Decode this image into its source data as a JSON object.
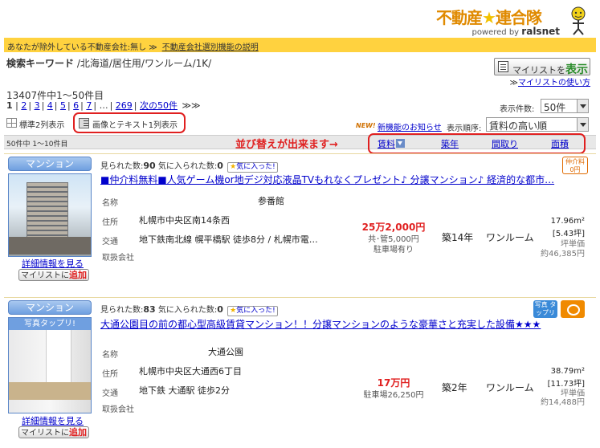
{
  "header": {
    "logo_text_left": "不動産",
    "logo_star": "★",
    "logo_text_right": "連合隊",
    "powered_prefix": "powered by",
    "powered_brand": "ralsnet"
  },
  "notice": {
    "text": "あなたが除外している不動産会社:無し",
    "link_sep": "≫",
    "link": "不動産会社選別機能の説明"
  },
  "search": {
    "label": "検索キーワード",
    "value": "/北海道/居住用/ワンルーム/1K/"
  },
  "mylist": {
    "button_prefix": "マイリストを",
    "button_big": "表示",
    "howto_sep": "≫",
    "howto": "マイリストの使い方"
  },
  "results": {
    "count_text": "13407件中1～50件目",
    "pages": [
      "1",
      "2",
      "3",
      "4",
      "5",
      "6",
      "7"
    ],
    "ellipsis": "…",
    "last_page": "269",
    "next": "次の50件",
    "next_arrows": "≫≫"
  },
  "controls": {
    "per_page_label": "表示件数:",
    "per_page_value": "50件",
    "view_two": "標準2列表示",
    "view_one": "画像とテキスト1列表示",
    "new_badge": "NEW!",
    "new_link": "新機能のお知らせ",
    "sort_label": "表示順序:",
    "sort_value": "賃料の高い順"
  },
  "sortbar": {
    "range": "50件中 1～10件目",
    "hint": "並び替えが出来ます→",
    "links": [
      "賃料",
      "築年",
      "間取り",
      "面積"
    ]
  },
  "labels": {
    "name": "名称",
    "address": "住所",
    "transport": "交通",
    "agent": "取扱会社",
    "seen_prefix": "見られた数:",
    "fav_prefix": "気に入られた数:",
    "fav_button": "気に入った!",
    "detail": "詳細情報を見る",
    "add_prefix": "マイリストに",
    "add_big": "追加"
  },
  "listings": [
    {
      "type": "マンション",
      "seen": "90",
      "fav": "0",
      "title": "■仲介料無料■人気ゲーム機or地デジ対応液晶TVもれなくプレゼント♪ 分譲マンション♪ 経済的な都市…",
      "name": "参番館",
      "address": "札幌市中央区南14条西",
      "transport": "地下鉄南北線 幌平橋駅 徒歩8分 / 札幌市電…",
      "rent": "25万2,000円",
      "rent_sub1": "共･管5,000円",
      "rent_sub2": "駐車場有り",
      "age": "築14年",
      "layout": "ワンルーム",
      "area_m2": "17.96m²",
      "area_tsubo": "[5.43坪]",
      "unit_label": "坪単価",
      "unit_price": "約46,385円",
      "badge": "仲介料 0円"
    },
    {
      "type": "マンション",
      "seen": "83",
      "fav": "0",
      "photo_banner": "写真タップリ!",
      "title": "大通公園目の前の都心型高級賃貸マンション！！分譲マンションのような豪華さと充実した設備★★★",
      "name": "大通公園",
      "address": "札幌市中央区大通西6丁目",
      "transport": "地下鉄 大通駅 徒歩2分",
      "rent": "17万円",
      "rent_sub1": "駐車場26,250円",
      "age": "築2年",
      "layout": "ワンルーム",
      "area_m2": "38.79m²",
      "area_tsubo": "[11.73坪]",
      "unit_label": "坪単価",
      "unit_price": "約14,488円",
      "badge": "写真 タップリ"
    }
  ]
}
